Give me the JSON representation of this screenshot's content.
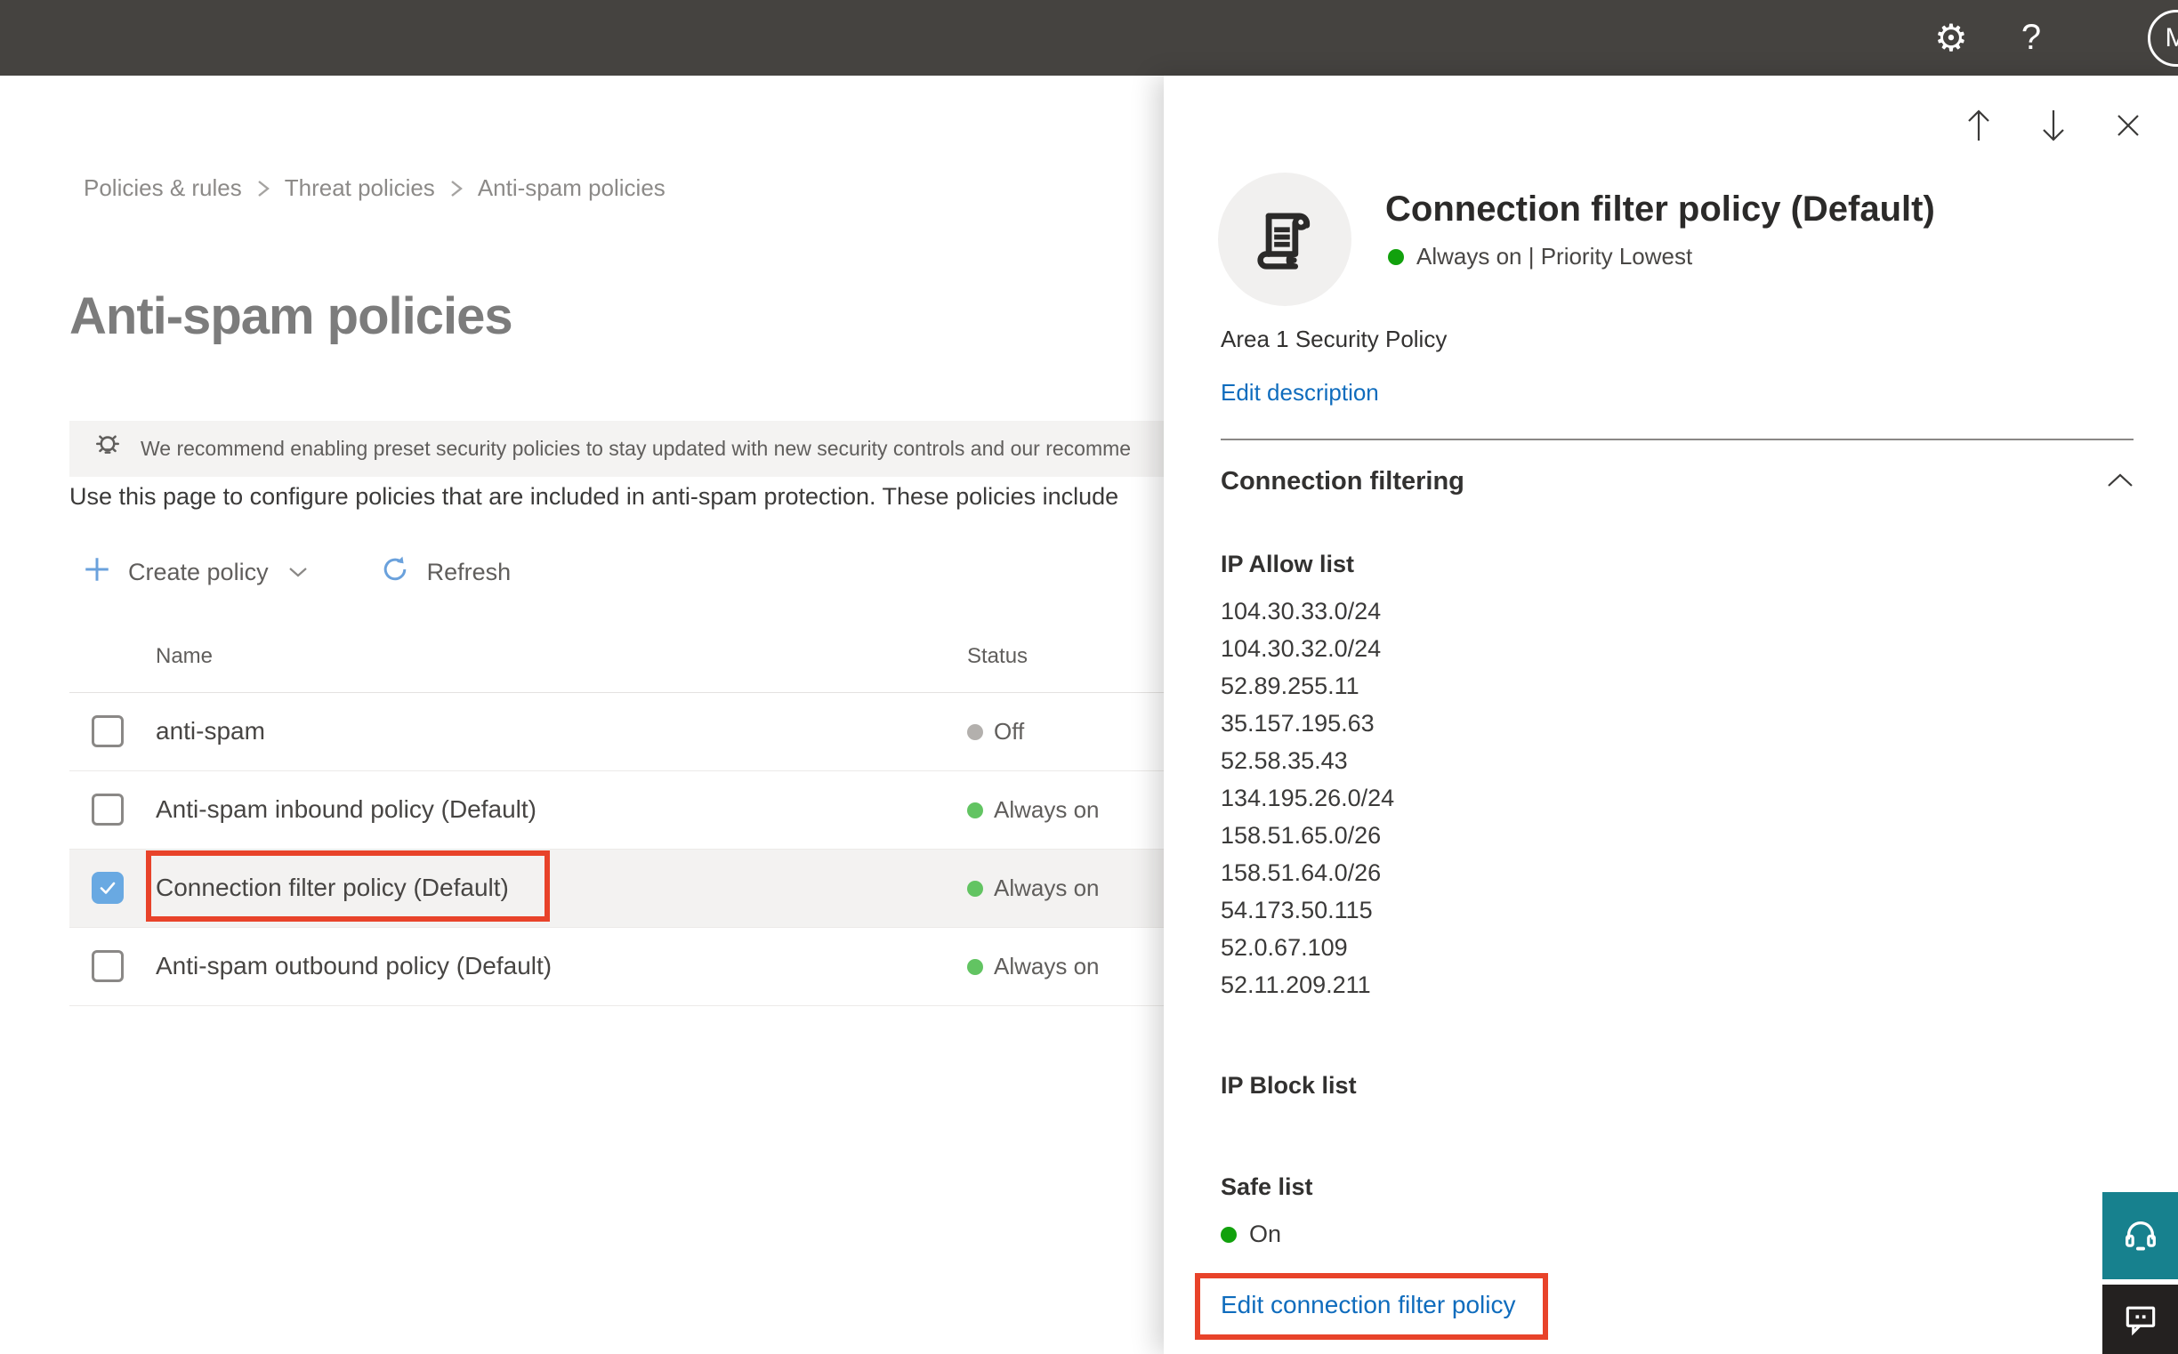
{
  "topbar": {
    "help_label": "?",
    "avatar_initial": "M"
  },
  "breadcrumb": {
    "items": [
      "Policies & rules",
      "Threat policies",
      "Anti-spam policies"
    ]
  },
  "page": {
    "title": "Anti-spam policies",
    "banner_text": "We recommend enabling preset security policies to stay updated with new security controls and our recomme",
    "intro_text": "Use this page to configure policies that are included in anti-spam protection. These policies include"
  },
  "toolbar": {
    "create_label": "Create policy",
    "refresh_label": "Refresh"
  },
  "table": {
    "columns": {
      "name": "Name",
      "status": "Status"
    },
    "rows": [
      {
        "name": "anti-spam",
        "status": "Off",
        "checked": false
      },
      {
        "name": "Anti-spam inbound policy (Default)",
        "status": "Always on",
        "checked": false
      },
      {
        "name": "Connection filter policy (Default)",
        "status": "Always on",
        "checked": true
      },
      {
        "name": "Anti-spam outbound policy (Default)",
        "status": "Always on",
        "checked": false
      }
    ]
  },
  "flyout": {
    "title": "Connection filter policy (Default)",
    "status_line": "Always on | Priority Lowest",
    "description": "Area 1 Security Policy",
    "edit_description_label": "Edit description",
    "section_title": "Connection filtering",
    "ip_allow": {
      "label": "IP Allow list",
      "items": [
        "104.30.33.0/24",
        "104.30.32.0/24",
        "52.89.255.11",
        "35.157.195.63",
        "52.58.35.43",
        "134.195.26.0/24",
        "158.51.65.0/26",
        "158.51.64.0/26",
        "54.173.50.115",
        "52.0.67.109",
        "52.11.209.211"
      ]
    },
    "ip_block": {
      "label": "IP Block list"
    },
    "safe_list": {
      "label": "Safe list",
      "value": "On"
    },
    "edit_link_label": "Edit connection filter policy"
  },
  "colors": {
    "topbar_bg": "#454340",
    "accent_blue": "#0f6cbd",
    "toolbar_icon_blue": "#6aa1dc",
    "checkbox_blue": "#69a9e2",
    "status_green": "#62c462",
    "status_green_vivid": "#12a10d",
    "status_gray": "#b3b0ad",
    "annotation_red": "#e8432a",
    "corner_teal": "#17818e",
    "corner_dark": "#242120"
  }
}
